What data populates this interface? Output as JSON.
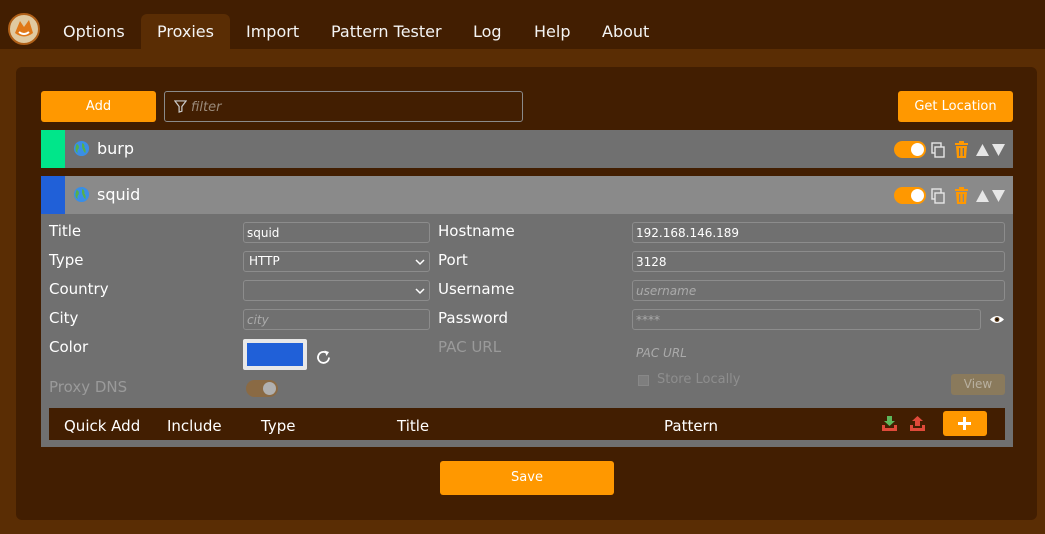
{
  "nav": {
    "tabs": [
      {
        "label": "Options"
      },
      {
        "label": "Proxies"
      },
      {
        "label": "Import"
      },
      {
        "label": "Pattern Tester"
      },
      {
        "label": "Log"
      },
      {
        "label": "Help"
      },
      {
        "label": "About"
      }
    ],
    "active_tab": "Proxies"
  },
  "toolbar": {
    "add_label": "Add",
    "filter_placeholder": "filter",
    "get_location_label": "Get Location"
  },
  "proxies": [
    {
      "name": "burp",
      "color": "#00e68a",
      "enabled": true,
      "expanded": false
    },
    {
      "name": "squid",
      "color": "#2060d8",
      "enabled": true,
      "expanded": true
    }
  ],
  "form": {
    "title_label": "Title",
    "title_value": "squid",
    "type_label": "Type",
    "type_value": "HTTP",
    "country_label": "Country",
    "country_value": "",
    "city_label": "City",
    "city_placeholder": "city",
    "color_label": "Color",
    "color_value": "#2060d8",
    "proxy_dns_label": "Proxy DNS",
    "hostname_label": "Hostname",
    "hostname_value": "192.168.146.189",
    "port_label": "Port",
    "port_value": "3128",
    "username_label": "Username",
    "username_placeholder": "username",
    "password_label": "Password",
    "password_placeholder": "****",
    "pac_url_label": "PAC URL",
    "pac_url_placeholder": "PAC URL",
    "store_locally_label": "Store Locally",
    "view_label": "View"
  },
  "patterns": {
    "headers": [
      "Quick Add",
      "Include",
      "Type",
      "Title",
      "Pattern"
    ]
  },
  "save_label": "Save",
  "colors": {
    "accent": "#ff9800",
    "nav_bg": "#421e01",
    "page_bg": "#5a2d04",
    "row_bg": "#707070"
  }
}
